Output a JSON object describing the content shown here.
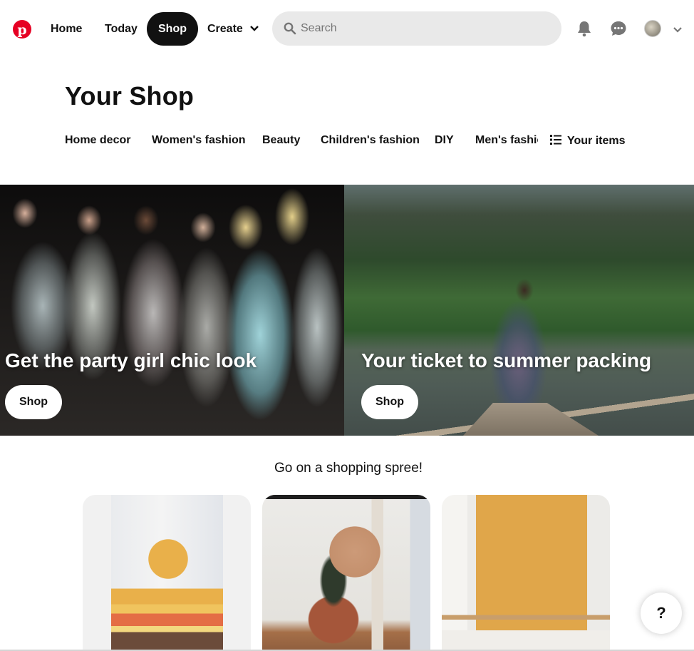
{
  "header": {
    "logo": "pinterest-logo",
    "nav": {
      "home": "Home",
      "today": "Today",
      "shop": "Shop",
      "create": "Create"
    },
    "search": {
      "placeholder": "Search",
      "value": ""
    },
    "icons": [
      "bell-icon",
      "chat-icon",
      "avatar",
      "chevron-down-icon"
    ]
  },
  "page": {
    "title": "Your Shop"
  },
  "categories": {
    "items": [
      "Home decor",
      "Women's fashion",
      "Beauty",
      "Children's fashion",
      "DIY",
      "Men's fashion"
    ],
    "your_items": "Your items"
  },
  "hero": [
    {
      "caption": "Get the party girl chic look",
      "button": "Shop"
    },
    {
      "caption": "Your ticket to summer packing",
      "button": "Shop"
    }
  ],
  "spree": {
    "title": "Go on a shopping spree!"
  },
  "help": {
    "label": "?"
  },
  "colors": {
    "brand": "#e60023",
    "active_nav": "#111111",
    "search_bg": "#e9e9e9"
  }
}
